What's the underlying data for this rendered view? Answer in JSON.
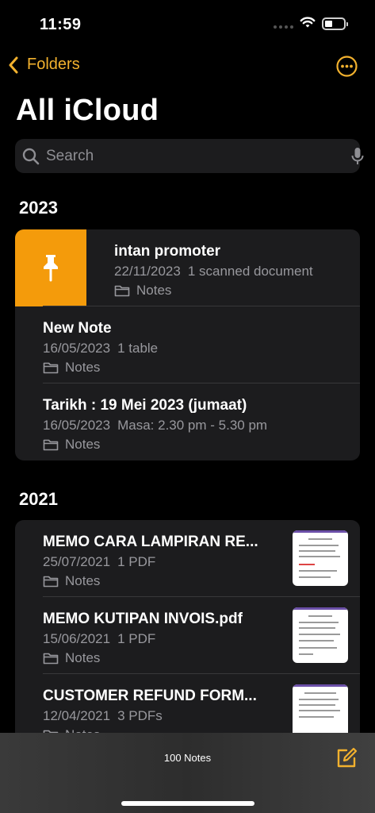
{
  "status": {
    "time": "11:59"
  },
  "nav": {
    "back_label": "Folders",
    "title": "All iCloud"
  },
  "search": {
    "placeholder": "Search"
  },
  "sections": [
    {
      "year": "2023",
      "notes": [
        {
          "title": "intan promoter",
          "date": "22/11/2023",
          "preview": "1 scanned document",
          "folder": "Notes",
          "pinned": true
        },
        {
          "title": "New Note",
          "date": "16/05/2023",
          "preview": "1 table",
          "folder": "Notes"
        },
        {
          "title": "Tarikh : 19 Mei 2023 (jumaat)",
          "date": "16/05/2023",
          "preview": "Masa: 2.30 pm - 5.30 pm",
          "folder": "Notes"
        }
      ]
    },
    {
      "year": "2021",
      "notes": [
        {
          "title": "MEMO CARA LAMPIRAN RE...",
          "date": "25/07/2021",
          "preview": "1 PDF",
          "folder": "Notes",
          "thumbnail": true
        },
        {
          "title": "MEMO KUTIPAN INVOIS.pdf",
          "date": "15/06/2021",
          "preview": "1 PDF",
          "folder": "Notes",
          "thumbnail": true
        },
        {
          "title": "CUSTOMER REFUND FORM...",
          "date": "12/04/2021",
          "preview": "3 PDFs",
          "folder": "Notes",
          "thumbnail": true
        }
      ]
    }
  ],
  "toolbar": {
    "count": "100 Notes"
  },
  "colors": {
    "accent": "#f2b12e",
    "pin": "#f49b0b",
    "card": "#1c1c1e",
    "secondary_text": "#98989d"
  },
  "icons": [
    "chevron-left-icon",
    "more-icon",
    "search-icon",
    "mic-icon",
    "pin-icon",
    "folder-icon",
    "compose-icon"
  ]
}
